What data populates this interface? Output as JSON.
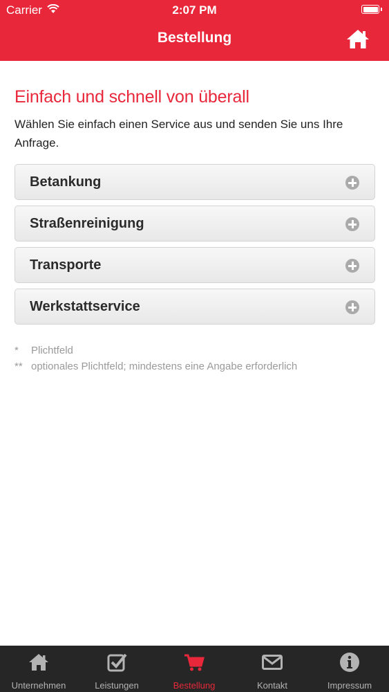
{
  "status_bar": {
    "carrier": "Carrier",
    "time": "2:07 PM"
  },
  "nav": {
    "title": "Bestellung",
    "home_icon": "home-icon"
  },
  "headline": "Einfach und schnell von überall",
  "intro": "Wählen Sie einfach einen Service aus und senden Sie uns Ihre Anfrage.",
  "services": [
    {
      "label": "Betankung"
    },
    {
      "label": "Straßenreinigung"
    },
    {
      "label": "Transporte"
    },
    {
      "label": "Werkstattservice"
    }
  ],
  "notes": [
    {
      "mark": "*",
      "text": "Plichtfeld"
    },
    {
      "mark": "**",
      "text": "optionales Plichtfeld; mindestens eine Angabe erforderlich"
    }
  ],
  "tabs": [
    {
      "label": "Unternehmen",
      "icon": "home-icon",
      "active": false
    },
    {
      "label": "Leistungen",
      "icon": "checkbox-icon",
      "active": false
    },
    {
      "label": "Bestellung",
      "icon": "cart-icon",
      "active": true
    },
    {
      "label": "Kontakt",
      "icon": "mail-icon",
      "active": false
    },
    {
      "label": "Impressum",
      "icon": "info-icon",
      "active": false
    }
  ],
  "colors": {
    "brand": "#e8283a",
    "tabbar": "#262626",
    "tab_inactive": "#b3b3b3",
    "note_text": "#9a9a9a"
  }
}
